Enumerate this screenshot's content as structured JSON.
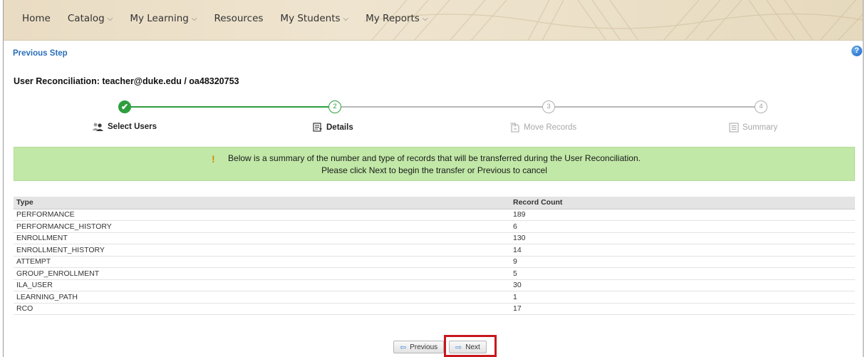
{
  "nav": {
    "items": [
      {
        "label": "Home",
        "dropdown": false
      },
      {
        "label": "Catalog",
        "dropdown": true
      },
      {
        "label": "My Learning",
        "dropdown": true
      },
      {
        "label": "Resources",
        "dropdown": false
      },
      {
        "label": "My Students",
        "dropdown": true
      },
      {
        "label": "My Reports",
        "dropdown": true
      }
    ]
  },
  "links": {
    "previous_step": "Previous Step",
    "help_icon": "?"
  },
  "page": {
    "title": "User Reconciliation: teacher@duke.edu / oa48320753"
  },
  "stepper": {
    "steps": [
      {
        "number": "✔",
        "label": "Select Users",
        "state": "done"
      },
      {
        "number": "2",
        "label": "Details",
        "state": "active"
      },
      {
        "number": "3",
        "label": "Move Records",
        "state": "pending"
      },
      {
        "number": "4",
        "label": "Summary",
        "state": "pending"
      }
    ]
  },
  "banner": {
    "icon": "!",
    "line1": "Below is a summary of the number and type of records that will be transferred during the User Reconciliation.",
    "line2": "Please click Next to begin the transfer or Previous to cancel"
  },
  "table": {
    "headers": [
      "Type",
      "Record Count"
    ],
    "rows": [
      [
        "PERFORMANCE",
        "189"
      ],
      [
        "PERFORMANCE_HISTORY",
        "6"
      ],
      [
        "ENROLLMENT",
        "130"
      ],
      [
        "ENROLLMENT_HISTORY",
        "14"
      ],
      [
        "ATTEMPT",
        "9"
      ],
      [
        "GROUP_ENROLLMENT",
        "5"
      ],
      [
        "ILA_USER",
        "30"
      ],
      [
        "LEARNING_PATH",
        "1"
      ],
      [
        "RCO",
        "17"
      ]
    ]
  },
  "buttons": {
    "previous": "Previous",
    "next": "Next"
  },
  "colors": {
    "accent_green": "#2e9e3f",
    "banner_bg": "#c1e8a7",
    "link_blue": "#2a6fba",
    "highlight_red": "#c8171e"
  }
}
